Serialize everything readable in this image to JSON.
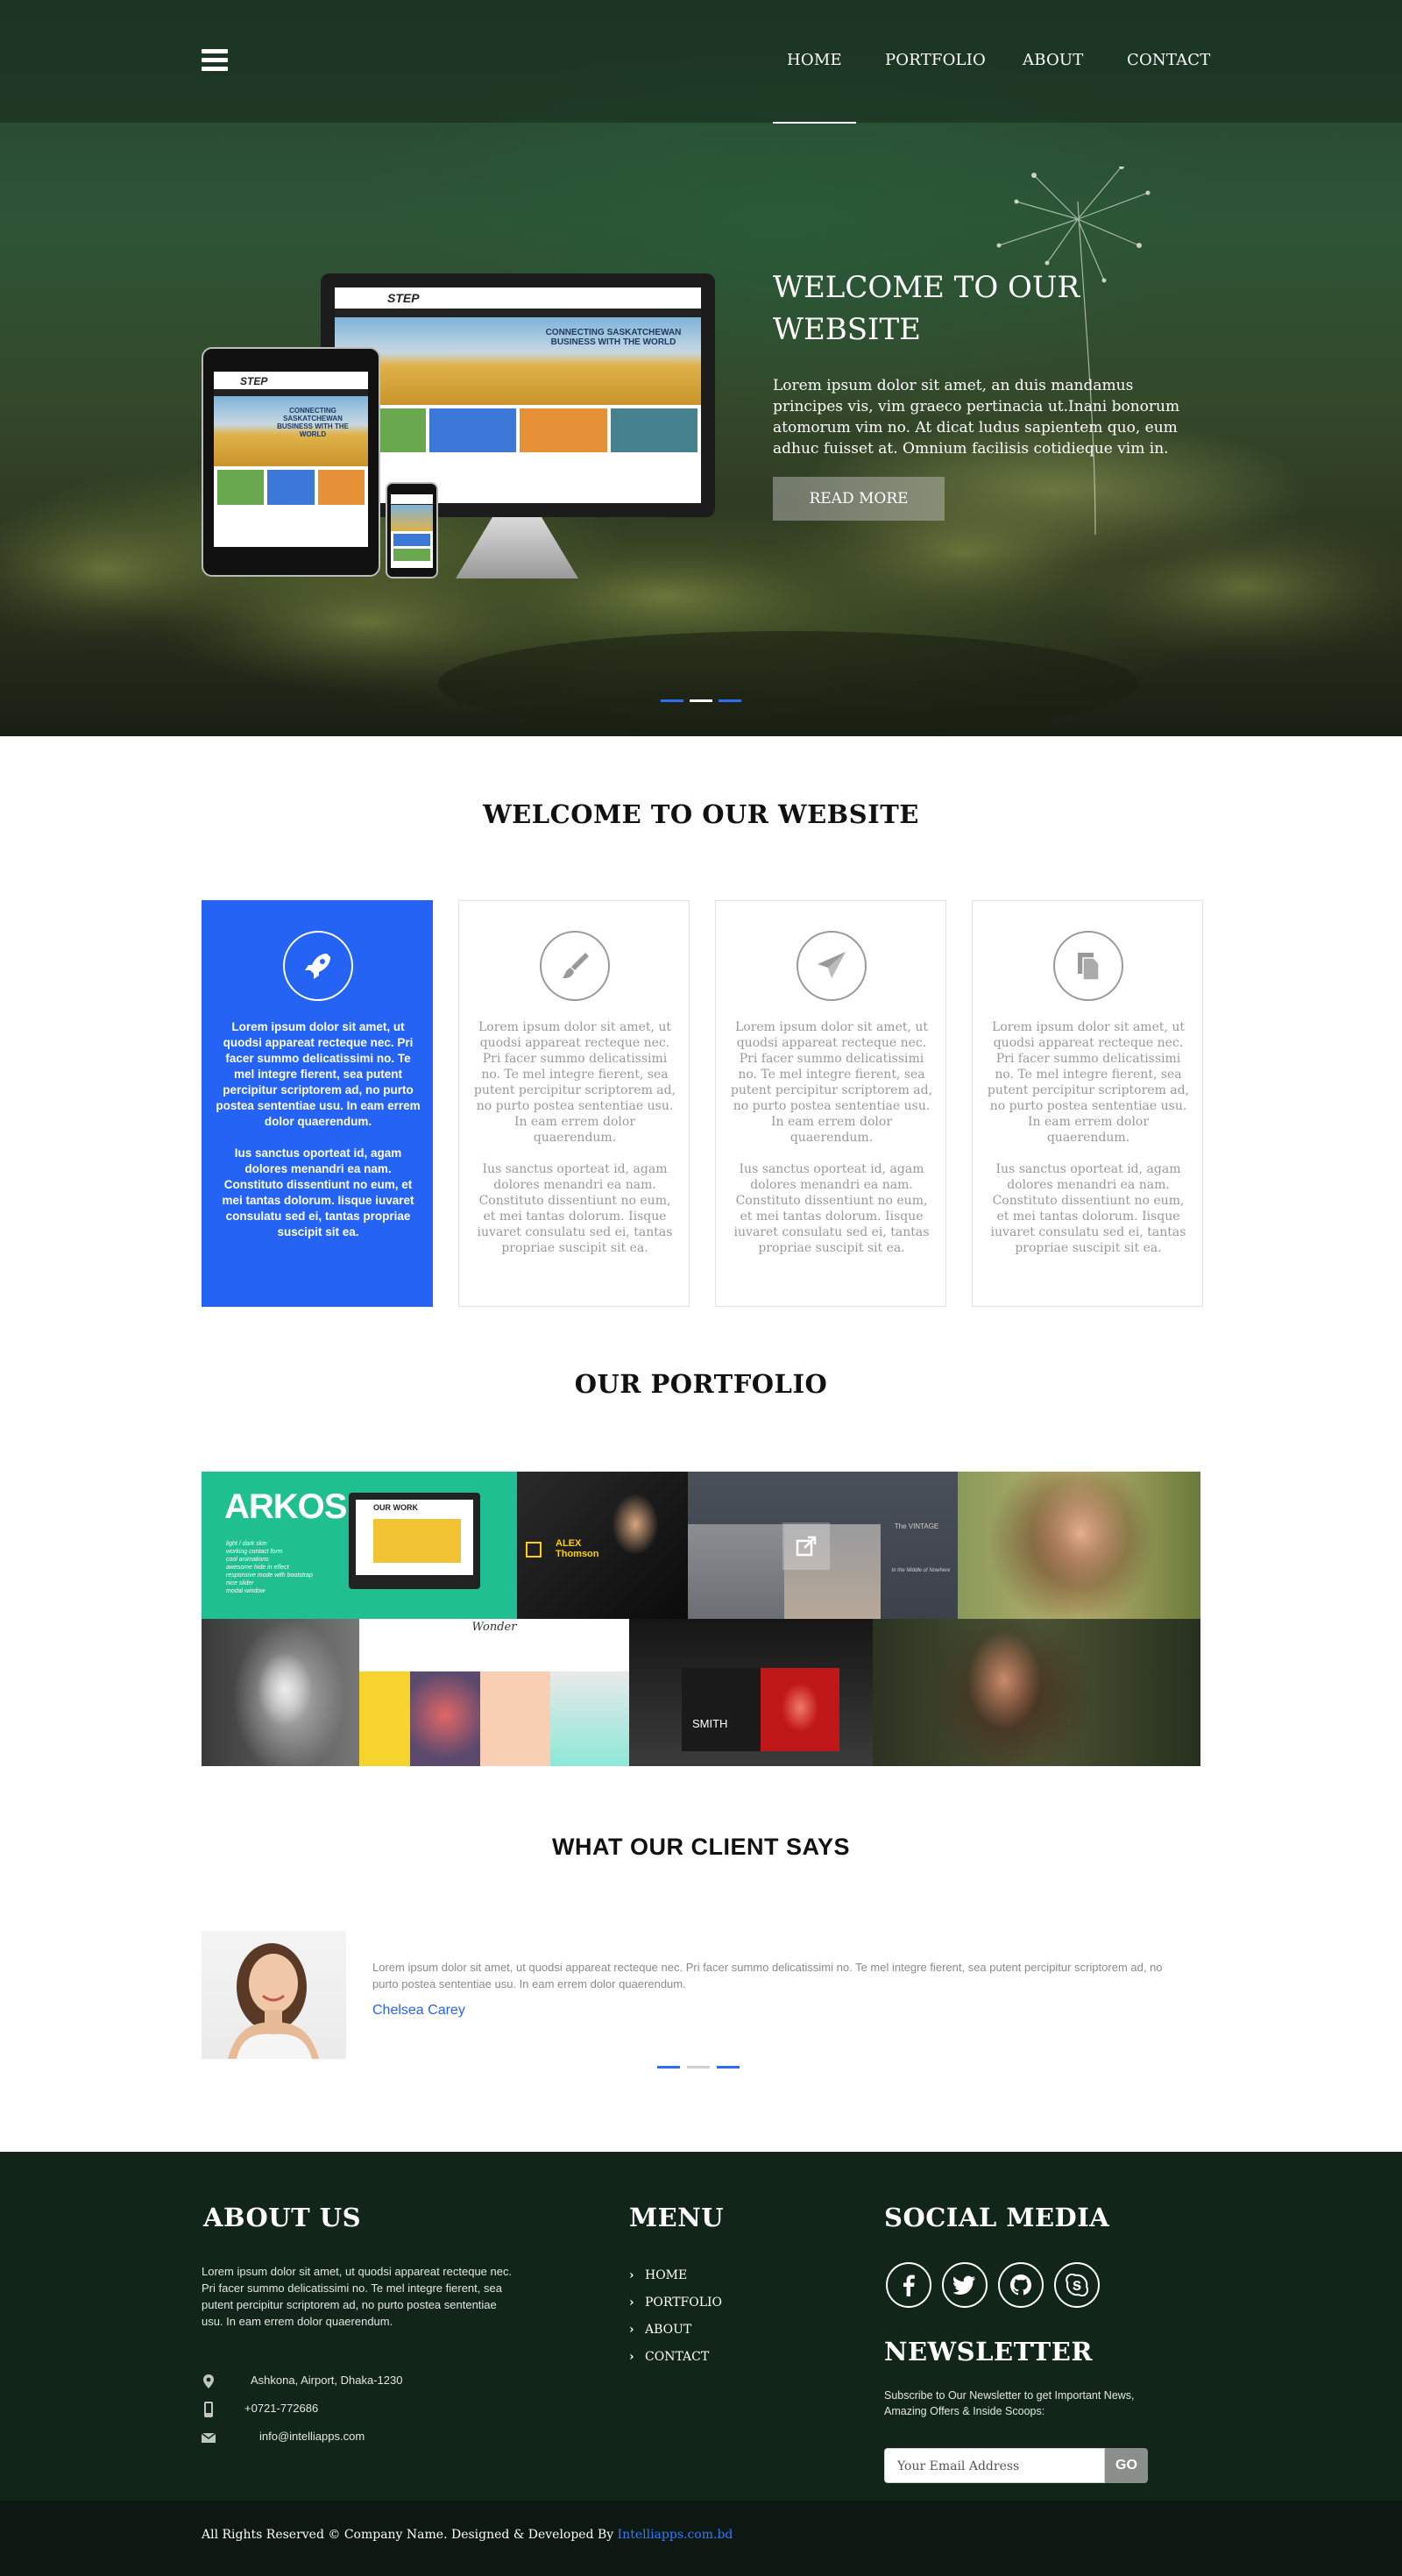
{
  "nav": {
    "menu_icon": "hamburger-icon",
    "items": [
      "HOME",
      "PORTFOLIO",
      "ABOUT",
      "CONTACT"
    ],
    "active": "HOME"
  },
  "hero": {
    "title": "WELCOME TO OUR WEBSITE",
    "text": "Lorem ipsum dolor sit amet, an duis mandamus principes vis, vim graeco pertinacia ut.Inani bonorum atomorum vim no. At dicat ludus sapientem quo, eum adhuc fuisset at. Omnium facilisis cotidieque vim in.",
    "button": "READ MORE",
    "device_site": {
      "logo": "STEP",
      "headline": "CONNECTING SASKATCHEWAN BUSINESS WITH THE WORLD"
    },
    "slider_dots": [
      "#2f6df5",
      "#ffffff",
      "#2f6df5"
    ]
  },
  "welcome": {
    "title": "WELCOME TO OUR WEBSITE",
    "cards": [
      {
        "icon": "rocket-icon",
        "p1": "Lorem ipsum dolor sit amet, ut quodsi appareat recteque nec. Pri facer summo delicatissimi no. Te mel integre fierent, sea putent percipitur scriptorem ad, no purto postea sententiae usu. In eam errem dolor quaerendum.",
        "p2": "Ius sanctus oporteat id, agam dolores menandri ea nam. Constituto dissentiunt no eum, et mei tantas dolorum. Iisque iuvaret consulatu sed ei, tantas propriae suscipit sit ea."
      },
      {
        "icon": "paintbrush-icon",
        "p1": "Lorem ipsum dolor sit amet, ut quodsi appareat recteque nec. Pri facer summo delicatissimi no. Te mel integre fierent, sea putent percipitur scriptorem ad, no purto postea sententiae usu. In eam errem dolor quaerendum.",
        "p2": "Ius sanctus oporteat id, agam dolores menandri ea nam. Constituto dissentiunt no eum, et mei tantas dolorum. Iisque iuvaret consulatu sed ei, tantas propriae suscipit sit ea."
      },
      {
        "icon": "paper-plane-icon",
        "p1": "Lorem ipsum dolor sit amet, ut quodsi appareat recteque nec. Pri facer summo delicatissimi no. Te mel integre fierent, sea putent percipitur scriptorem ad, no purto postea sententiae usu. In eam errem dolor quaerendum.",
        "p2": "Ius sanctus oporteat id, agam dolores menandri ea nam. Constituto dissentiunt no eum, et mei tantas dolorum. Iisque iuvaret consulatu sed ei, tantas propriae suscipit sit ea."
      },
      {
        "icon": "documents-icon",
        "p1": "Lorem ipsum dolor sit amet, ut quodsi appareat recteque nec. Pri facer summo delicatissimi no. Te mel integre fierent, sea putent percipitur scriptorem ad, no purto postea sententiae usu. In eam errem dolor quaerendum.",
        "p2": "Ius sanctus oporteat id, agam dolores menandri ea nam. Constituto dissentiunt no eum, et mei tantas dolorum. Iisque iuvaret consulatu sed ei, tantas propriae suscipit sit ea."
      }
    ]
  },
  "portfolio": {
    "title": "OUR PORTFOLIO",
    "items": {
      "arkos_title": "ARKOS",
      "arkos_tagline": "light / dark skin\nworking contact form\ncool animations\nawesome hide in effect\nresponsive mode with bootstrap\nnice slider\nmodal window",
      "arkos_screen": "OUR WORK",
      "alex": "ALEX\nThomson",
      "vintage": "The VINTAGE",
      "vintage_sub": "In the Middle of Nowhere",
      "wonder": "Wonder",
      "smith": "SMITH",
      "link_icon": "external-link-icon"
    }
  },
  "testimonial": {
    "title": "WHAT OUR CLIENT SAYS",
    "quote": "Lorem ipsum dolor sit amet, ut quodsi appareat recteque nec. Pri facer summo delicatissimi no. Te mel integre fierent, sea putent percipitur scriptorem ad, no purto postea sententiae usu. In eam errem dolor quaerendum.",
    "name": "Chelsea Carey",
    "dots": [
      "#2f6df5",
      "#cfcfcf",
      "#2f6df5"
    ]
  },
  "footer": {
    "about_title": "ABOUT US",
    "about_text": "Lorem ipsum dolor sit amet, ut quodsi appareat recteque nec. Pri facer summo delicatissimi no. Te mel integre fierent, sea putent percipitur scriptorem ad, no purto postea sententiae usu. In eam errem dolor quaerendum.",
    "address": "Ashkona, Airport, Dhaka-1230",
    "phone": "+0721-772686",
    "email": "info@intelliapps.com",
    "menu_title": "MENU",
    "menu": [
      "HOME",
      "PORTFOLIO",
      "ABOUT",
      "CONTACT"
    ],
    "social_title": "SOCIAL MEDIA",
    "social": [
      "facebook-icon",
      "twitter-icon",
      "github-icon",
      "skype-icon"
    ],
    "newsletter_title": "NEWSLETTER",
    "newsletter_text": "Subscribe to Our Newsletter to get Important News, Amazing Offers & Inside Scoops:",
    "newsletter_placeholder": "Your Email Address",
    "newsletter_button": "GO",
    "copyright_text": "All Rights Reserved © Company Name. Designed & Developed By ",
    "copyright_link": "Intelliapps.com.bd"
  }
}
